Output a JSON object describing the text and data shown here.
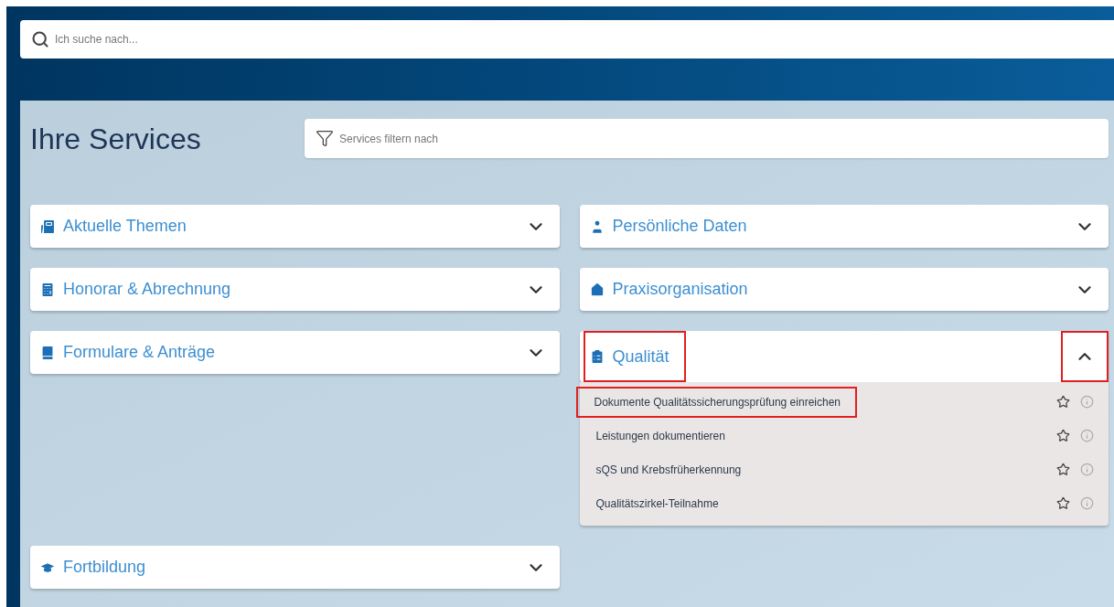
{
  "search": {
    "placeholder": "Ich suche nach..."
  },
  "services": {
    "title": "Ihre Services",
    "filter": {
      "placeholder": "Services filtern nach"
    },
    "sections": [
      {
        "title": "Aktuelle Themen",
        "expanded": false,
        "highlighted": false,
        "toggle_highlighted": false
      },
      {
        "title": "Persönliche Daten",
        "expanded": false,
        "highlighted": false,
        "toggle_highlighted": false
      },
      {
        "title": "Honorar & Abrechnung",
        "expanded": false,
        "highlighted": false,
        "toggle_highlighted": false
      },
      {
        "title": "Praxisorganisation",
        "expanded": false,
        "highlighted": false,
        "toggle_highlighted": false
      },
      {
        "title": "Formulare & Anträge",
        "expanded": false,
        "highlighted": false,
        "toggle_highlighted": false
      },
      {
        "title": "Qualität",
        "expanded": true,
        "highlighted": true,
        "toggle_highlighted": true,
        "items": [
          {
            "label": "Dokumente Qualitätssicherungsprüfung einreichen",
            "highlighted": true
          },
          {
            "label": "Leistungen dokumentieren",
            "highlighted": false
          },
          {
            "label": "sQS und Krebsfrüherkennung",
            "highlighted": false
          },
          {
            "label": "Qualitätszirkel-Teilnahme",
            "highlighted": false
          }
        ]
      },
      {
        "title": "Fortbildung",
        "expanded": false,
        "highlighted": false,
        "toggle_highlighted": false
      }
    ]
  }
}
